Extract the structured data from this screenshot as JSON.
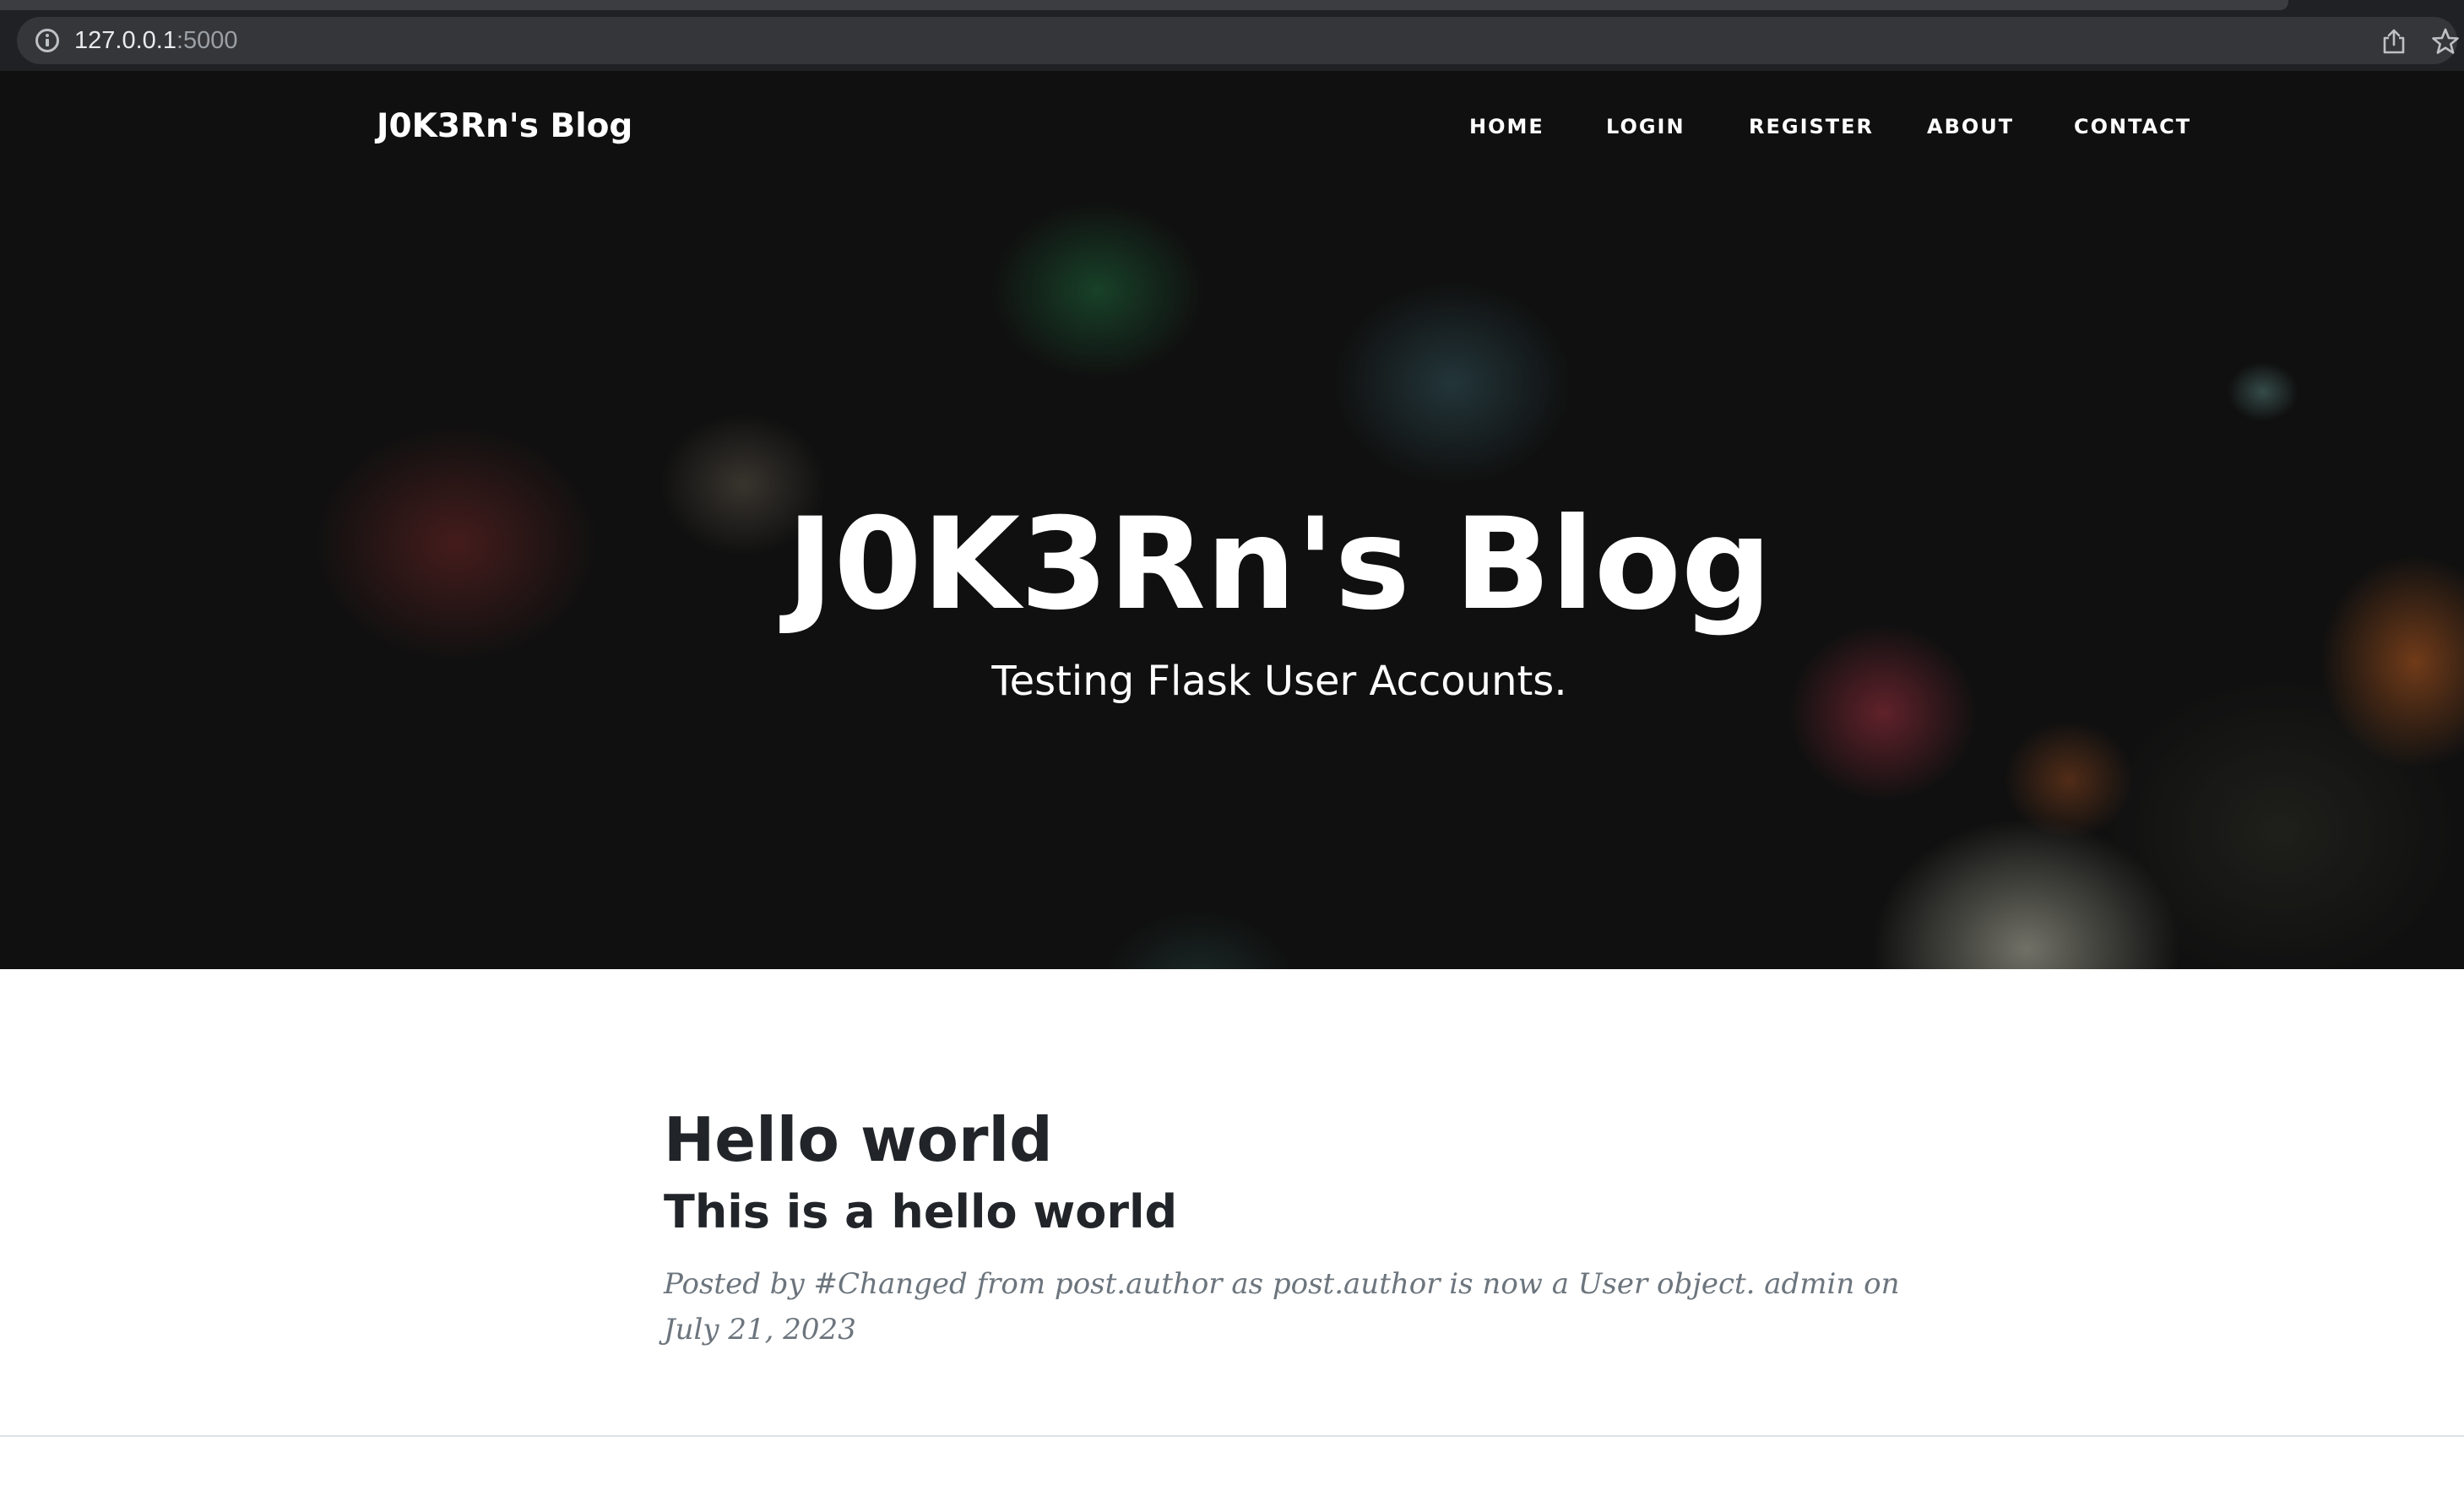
{
  "browser": {
    "url_host": "127.0.0.1",
    "url_port": ":5000"
  },
  "navbar": {
    "brand": "J0K3Rn's Blog",
    "links": [
      "Home",
      "Login",
      "Register",
      "About",
      "Contact"
    ]
  },
  "hero": {
    "title": "J0K3Rn's Blog",
    "subtitle": "Testing Flask User Accounts."
  },
  "posts": [
    {
      "title": "Hello world",
      "subtitle": "This is a hello world",
      "meta": "Posted by #Changed from post.author as post.author is now a User object. admin on July 21, 2023"
    }
  ],
  "icons": {
    "info": "info-icon",
    "share": "share-icon",
    "bookmark": "star-icon"
  },
  "colors": {
    "hero_text": "#ffffff",
    "heading_text": "#212529",
    "meta_text": "#6c757d",
    "browser_bar": "#202124"
  }
}
